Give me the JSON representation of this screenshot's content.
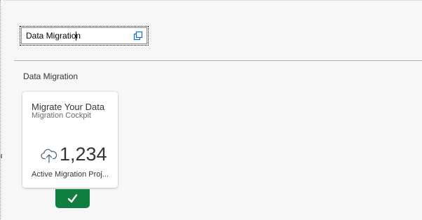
{
  "search": {
    "value": "Data Migration",
    "value_help_icon": "value-help-icon"
  },
  "group": {
    "title": "Data Migration"
  },
  "tile": {
    "title": "Migrate Your Data",
    "subtitle": "Migration Cockpit",
    "icon": "cloud-upload-icon",
    "number": "1,234",
    "footer": "Active Migration Proj..."
  },
  "selection": {
    "icon": "checkmark-icon",
    "color": "#107e3e"
  },
  "colors": {
    "background": "#f7f7f7",
    "tile_background": "#ffffff",
    "text": "#32363a",
    "accent_icon": "#556b82"
  }
}
